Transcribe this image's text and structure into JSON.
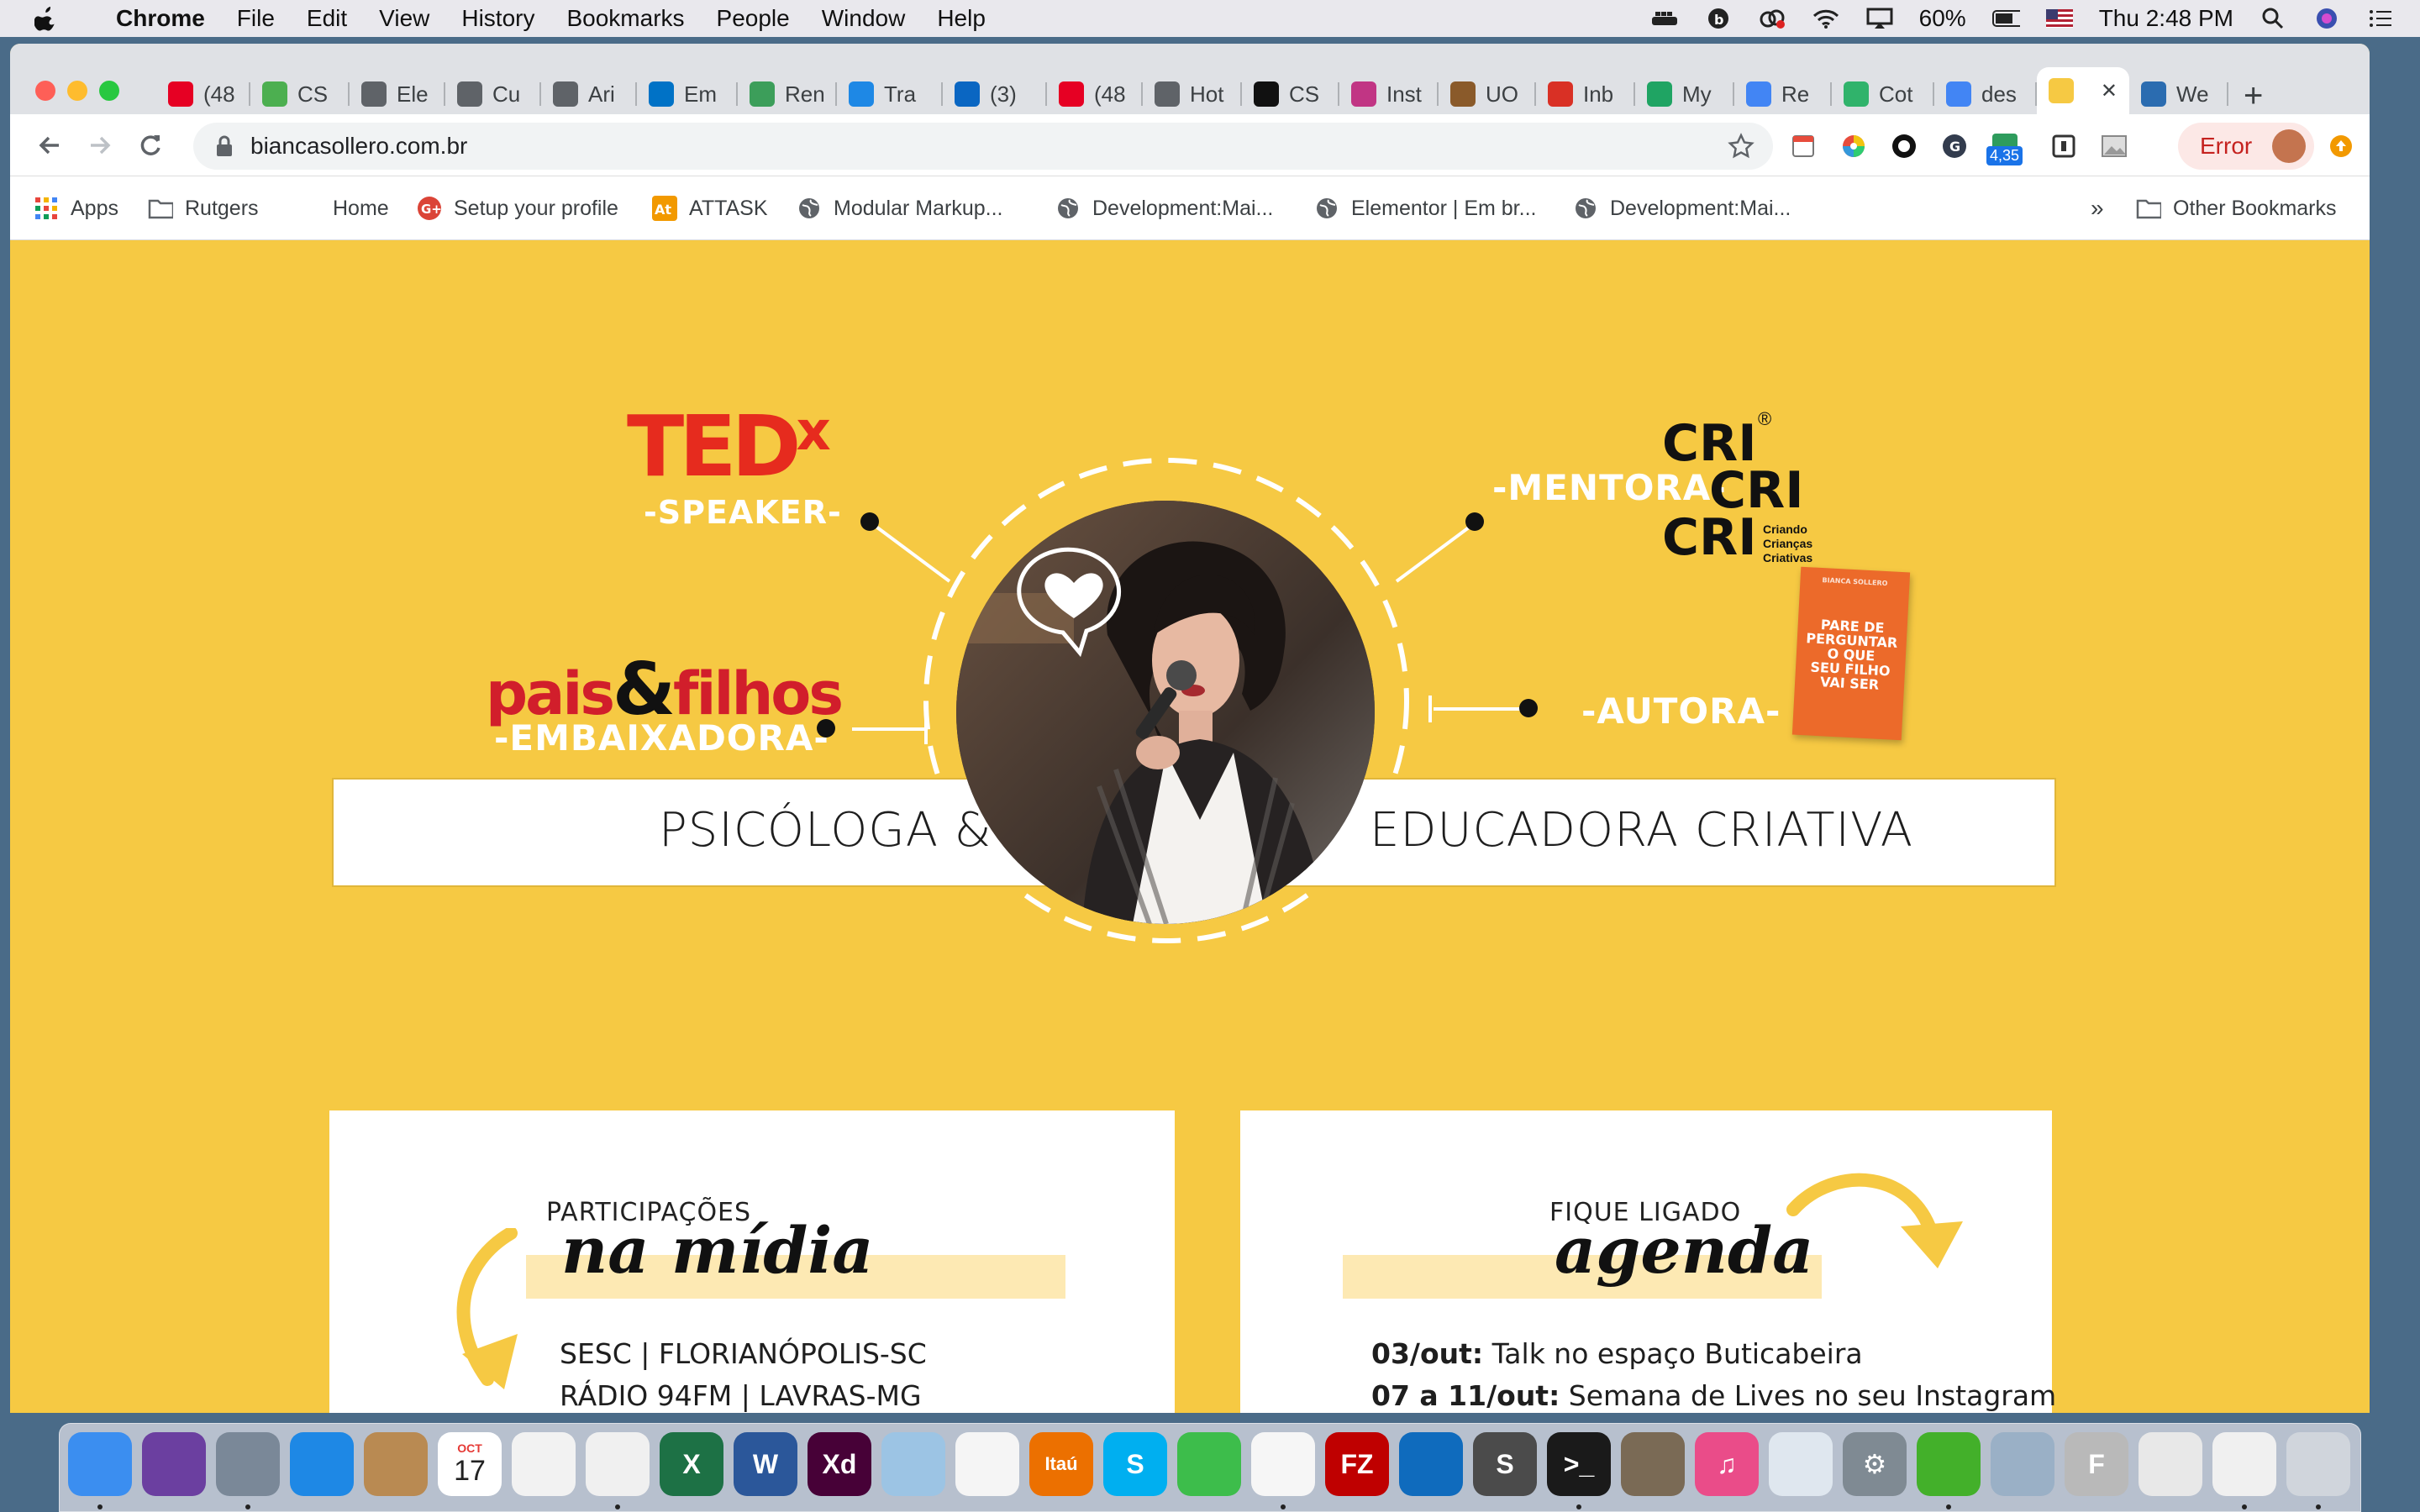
{
  "menubar": {
    "app": "Chrome",
    "items": [
      "File",
      "Edit",
      "View",
      "History",
      "Bookmarks",
      "People",
      "Window",
      "Help"
    ],
    "battery": "60%",
    "clock": "Thu 2:48 PM"
  },
  "tabs": [
    {
      "label": "(48",
      "icon": "pinterest-icon",
      "color": "#e60023"
    },
    {
      "label": "CS",
      "icon": "css-icon",
      "color": "#4caf50"
    },
    {
      "label": "Ele",
      "icon": "globe-icon",
      "color": "#5f6368"
    },
    {
      "label": "Cu",
      "icon": "globe-icon",
      "color": "#5f6368"
    },
    {
      "label": "Ari",
      "icon": "globe-icon",
      "color": "#5f6368"
    },
    {
      "label": "Em",
      "icon": "outlook-icon",
      "color": "#0072c6"
    },
    {
      "label": "Ren",
      "icon": "rentals-icon",
      "color": "#3c9e5a"
    },
    {
      "label": "Tra",
      "icon": "trello-icon",
      "color": "#1e88e5"
    },
    {
      "label": "(3)",
      "icon": "linkedin-icon",
      "color": "#0a66c2"
    },
    {
      "label": "(48",
      "icon": "pinterest-icon",
      "color": "#e60023"
    },
    {
      "label": "Hot",
      "icon": "globe-icon",
      "color": "#5f6368"
    },
    {
      "label": "CS",
      "icon": "github-icon",
      "color": "#111111"
    },
    {
      "label": "Inst",
      "icon": "instagram-icon",
      "color": "#c13584"
    },
    {
      "label": "UO",
      "icon": "uo-icon",
      "color": "#8a5a2a"
    },
    {
      "label": "Inb",
      "icon": "gmail-icon",
      "color": "#d93025"
    },
    {
      "label": "My",
      "icon": "drive-icon",
      "color": "#1fa463"
    },
    {
      "label": "Re",
      "icon": "docs-icon",
      "color": "#4285f4"
    },
    {
      "label": "Cot",
      "icon": "search-q-icon",
      "color": "#30b36b"
    },
    {
      "label": "des",
      "icon": "google-icon",
      "color": "#4285f4"
    },
    {
      "label": "",
      "icon": "site-icon",
      "color": "#f6c943",
      "active": true
    },
    {
      "label": "We",
      "icon": "webpack-icon",
      "color": "#2b6cb0"
    }
  ],
  "omnibox": {
    "url": "biancasollero.com.br"
  },
  "extensions": {
    "badge": "4,35"
  },
  "profile": {
    "error_label": "Error"
  },
  "bookmarks": {
    "items": [
      {
        "label": "Apps",
        "icon": "apps-grid-icon"
      },
      {
        "label": "Rutgers",
        "icon": "folder-icon"
      },
      {
        "label": "Home",
        "icon": ""
      },
      {
        "label": "Setup your profile",
        "icon": "google-plus-icon"
      },
      {
        "label": "ATTASK",
        "icon": "attask-icon"
      },
      {
        "label": "Modular Markup...",
        "icon": "globe-icon"
      },
      {
        "label": "Development:Mai...",
        "icon": "globe-icon"
      },
      {
        "label": "Elementor | Em br...",
        "icon": "globe-icon"
      },
      {
        "label": "Development:Mai...",
        "icon": "globe-icon"
      }
    ],
    "overflow": "»",
    "other": "Other Bookmarks"
  },
  "hero": {
    "ted_logo": "TED",
    "ted_x": "x",
    "speaker": "-SPEAKER-",
    "pais_logo_a": "pais",
    "pais_amp": "&",
    "pais_logo_b": "filhos",
    "embaixadora": "-EMBAIXADORA-",
    "mentora": "-MENTORA-",
    "cricri": [
      "CRI",
      "CRI",
      "CRI"
    ],
    "cricri_tagline": [
      "Criando",
      "Crianças",
      "Criativas"
    ],
    "cricri_mark": "®",
    "autora": "-AUTORA-",
    "book_author": "BIANCA SOLLERO",
    "book_title": [
      "PARE DE",
      "PERGUNTAR",
      "O QUE",
      "SEU FILHO",
      "VAI SER"
    ],
    "banner_left": "PSICÓLOGA &",
    "banner_right": "EDUCADORA CRIATIVA"
  },
  "media_card": {
    "small": "PARTICIPAÇÕES",
    "script": "na mídia",
    "lines": [
      "SESC | FLORIANÓPOLIS-SC",
      "RÁDIO 94FM | LAVRAS-MG"
    ]
  },
  "agenda_card": {
    "small": "FIQUE LIGADO",
    "script": "agenda",
    "items": [
      {
        "date": "03/out:",
        "text": " Talk no espaço Buticabeira"
      },
      {
        "date": "07 a 11/out:",
        "text": " Semana de Lives no seu Instagram"
      }
    ]
  },
  "dock": {
    "calendar_month": "OCT",
    "calendar_day": "17",
    "items": [
      {
        "name": "finder-icon",
        "color": "#3b8ef0",
        "glyph": ""
      },
      {
        "name": "siri-icon",
        "color": "#6b3fa0",
        "glyph": ""
      },
      {
        "name": "launchpad-icon",
        "color": "#7a8898",
        "glyph": ""
      },
      {
        "name": "safari-icon",
        "color": "#1e88e5",
        "glyph": ""
      },
      {
        "name": "contacts-icon",
        "color": "#b98a52",
        "glyph": ""
      },
      {
        "name": "calendar-icon",
        "color": "#ffffff",
        "glyph": ""
      },
      {
        "name": "reminders-icon",
        "color": "#f2f2f2",
        "glyph": ""
      },
      {
        "name": "chrome-icon",
        "color": "#f0f0f0",
        "glyph": ""
      },
      {
        "name": "excel-icon",
        "color": "#1d7145",
        "glyph": "X"
      },
      {
        "name": "word-icon",
        "color": "#2b579a",
        "glyph": "W"
      },
      {
        "name": "xd-icon",
        "color": "#470137",
        "glyph": "Xd"
      },
      {
        "name": "preview-icon",
        "color": "#9cc4e4",
        "glyph": ""
      },
      {
        "name": "photos-icon",
        "color": "#f5f5f5",
        "glyph": ""
      },
      {
        "name": "itau-icon",
        "color": "#ec7000",
        "glyph": "Itaú"
      },
      {
        "name": "skype-icon",
        "color": "#00aff0",
        "glyph": "S"
      },
      {
        "name": "facetime-icon",
        "color": "#3dbd4b",
        "glyph": ""
      },
      {
        "name": "textedit-icon",
        "color": "#f6f6f6",
        "glyph": ""
      },
      {
        "name": "filezilla-icon",
        "color": "#bf0000",
        "glyph": "FZ"
      },
      {
        "name": "vscode-icon",
        "color": "#0f6bbd",
        "glyph": ""
      },
      {
        "name": "sublime-icon",
        "color": "#4b4b4b",
        "glyph": "S"
      },
      {
        "name": "terminal-icon",
        "color": "#1a1a1a",
        "glyph": ">_"
      },
      {
        "name": "gimp-icon",
        "color": "#7a6a55",
        "glyph": ""
      },
      {
        "name": "itunes-icon",
        "color": "#ea4c89",
        "glyph": "♫"
      },
      {
        "name": "sequel-pro-icon",
        "color": "#dfe7ef",
        "glyph": ""
      },
      {
        "name": "system-preferences-icon",
        "color": "#7f8a93",
        "glyph": "⚙"
      },
      {
        "name": "evernote-icon",
        "color": "#43b02a",
        "glyph": ""
      },
      {
        "name": "image-capture-icon",
        "color": "#9ab0c6",
        "glyph": ""
      },
      {
        "name": "fontbook-icon",
        "color": "#b9b9b9",
        "glyph": "F"
      },
      {
        "name": "document-icon",
        "color": "#e8e8e8",
        "glyph": ""
      },
      {
        "name": "window-thumbnail-icon",
        "color": "#f0f0f0",
        "glyph": ""
      },
      {
        "name": "trash-icon",
        "color": "#d0d5dc",
        "glyph": ""
      }
    ]
  }
}
